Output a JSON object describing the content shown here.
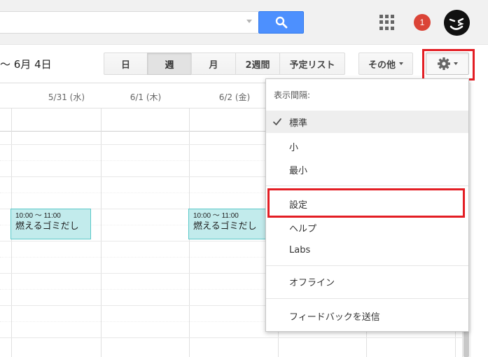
{
  "header": {
    "search": {
      "value": "",
      "placeholder": ""
    },
    "notification_count": "1"
  },
  "toolbar": {
    "date_range": "～ 6月 4日",
    "views": [
      {
        "label": "日",
        "active": false
      },
      {
        "label": "週",
        "active": true
      },
      {
        "label": "月",
        "active": false
      },
      {
        "label": "2週間",
        "active": false
      },
      {
        "label": "予定リスト",
        "active": false
      }
    ],
    "more_label": "その他"
  },
  "calendar": {
    "day_headers": [
      "5/31 (水)",
      "6/1 (木)",
      "6/2 (金)"
    ],
    "events": [
      {
        "time": "10:00 ～ 11:00",
        "title": "燃えるゴミだし",
        "color": "#c2ebec"
      },
      {
        "time": "10:00 ～ 11:00",
        "title": "燃えるゴミだし",
        "color": "#c2ebec"
      }
    ]
  },
  "menu": {
    "header": "表示間隔:",
    "density_options": [
      {
        "label": "標準",
        "selected": true
      },
      {
        "label": "小",
        "selected": false
      },
      {
        "label": "最小",
        "selected": false
      }
    ],
    "items": {
      "settings": "設定",
      "help": "ヘルプ",
      "labs": "Labs",
      "offline": "オフライン",
      "feedback": "フィードバックを送信"
    }
  },
  "colors": {
    "accent_blue": "#4d90fe",
    "highlight_red": "#e31e24",
    "event_fill": "#c2ebec",
    "event_border": "#5ac8c9",
    "badge_red": "#db4437"
  }
}
